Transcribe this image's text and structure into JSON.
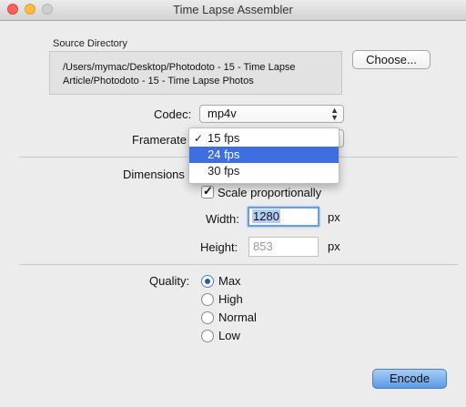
{
  "window": {
    "title": "Time Lapse Assembler"
  },
  "source": {
    "label": "Source Directory",
    "path_line1": "/Users/mymac/Desktop/Photodoto - 15 - Time Lapse",
    "path_line2": "Article/Photodoto - 15 - Time Lapse Photos",
    "choose_label": "Choose..."
  },
  "codec": {
    "label": "Codec:",
    "value": "mp4v"
  },
  "framerate": {
    "label": "Framerate",
    "options": [
      {
        "label": "15 fps",
        "checked": true,
        "highlighted": false
      },
      {
        "label": "24 fps",
        "checked": false,
        "highlighted": true
      },
      {
        "label": "30 fps",
        "checked": false,
        "highlighted": false
      }
    ],
    "check_glyph": "✓"
  },
  "dimensions": {
    "label": "Dimensions",
    "scale_label": "Scale proportionally",
    "scale_checked": true,
    "check_glyph": "✓",
    "width_label": "Width:",
    "width_value": "1280",
    "height_label": "Height:",
    "height_value": "853",
    "unit": "px"
  },
  "quality": {
    "label": "Quality:",
    "options": [
      {
        "label": "Max",
        "selected": true
      },
      {
        "label": "High",
        "selected": false
      },
      {
        "label": "Normal",
        "selected": false
      },
      {
        "label": "Low",
        "selected": false
      }
    ]
  },
  "encode_label": "Encode",
  "colors": {
    "accent": "#3d6fe0",
    "close": "#fc615d",
    "minimize": "#fdbc40"
  }
}
